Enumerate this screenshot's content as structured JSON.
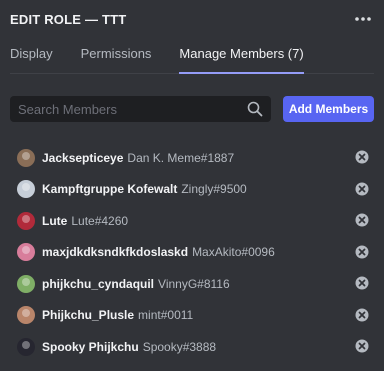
{
  "header": {
    "title": "EDIT ROLE — TTT"
  },
  "tabs": [
    {
      "label": "Display"
    },
    {
      "label": "Permissions"
    },
    {
      "label": "Manage Members (7)"
    }
  ],
  "search": {
    "placeholder": "Search Members",
    "value": ""
  },
  "add_button": {
    "label": "Add Members"
  },
  "colors": {
    "accent": "#5865f2",
    "tab_underline": "#949cf7",
    "background": "#313338",
    "input_bg": "#1e1f22"
  },
  "members": [
    {
      "display_name": "Jacksepticeye",
      "tag": "Dan K. Meme#1887",
      "avatar_color": "#8a6e57"
    },
    {
      "display_name": "Kampftgruppe Kofewalt",
      "tag": "Zingly#9500",
      "avatar_color": "#c6ced8"
    },
    {
      "display_name": "Lute",
      "tag": "Lute#4260",
      "avatar_color": "#b12a3a"
    },
    {
      "display_name": "maxjdkdksndkfkdoslaskd",
      "tag": "MaxAkito#0096",
      "avatar_color": "#d87d9b"
    },
    {
      "display_name": "phijkchu_cyndaquil",
      "tag": "VinnyG#8116",
      "avatar_color": "#7fae66"
    },
    {
      "display_name": "Phijkchu_Plusle",
      "tag": "mint#0011",
      "avatar_color": "#b9856a"
    },
    {
      "display_name": "Spooky Phijkchu",
      "tag": "Spooky#3888",
      "avatar_color": "#262630"
    }
  ]
}
